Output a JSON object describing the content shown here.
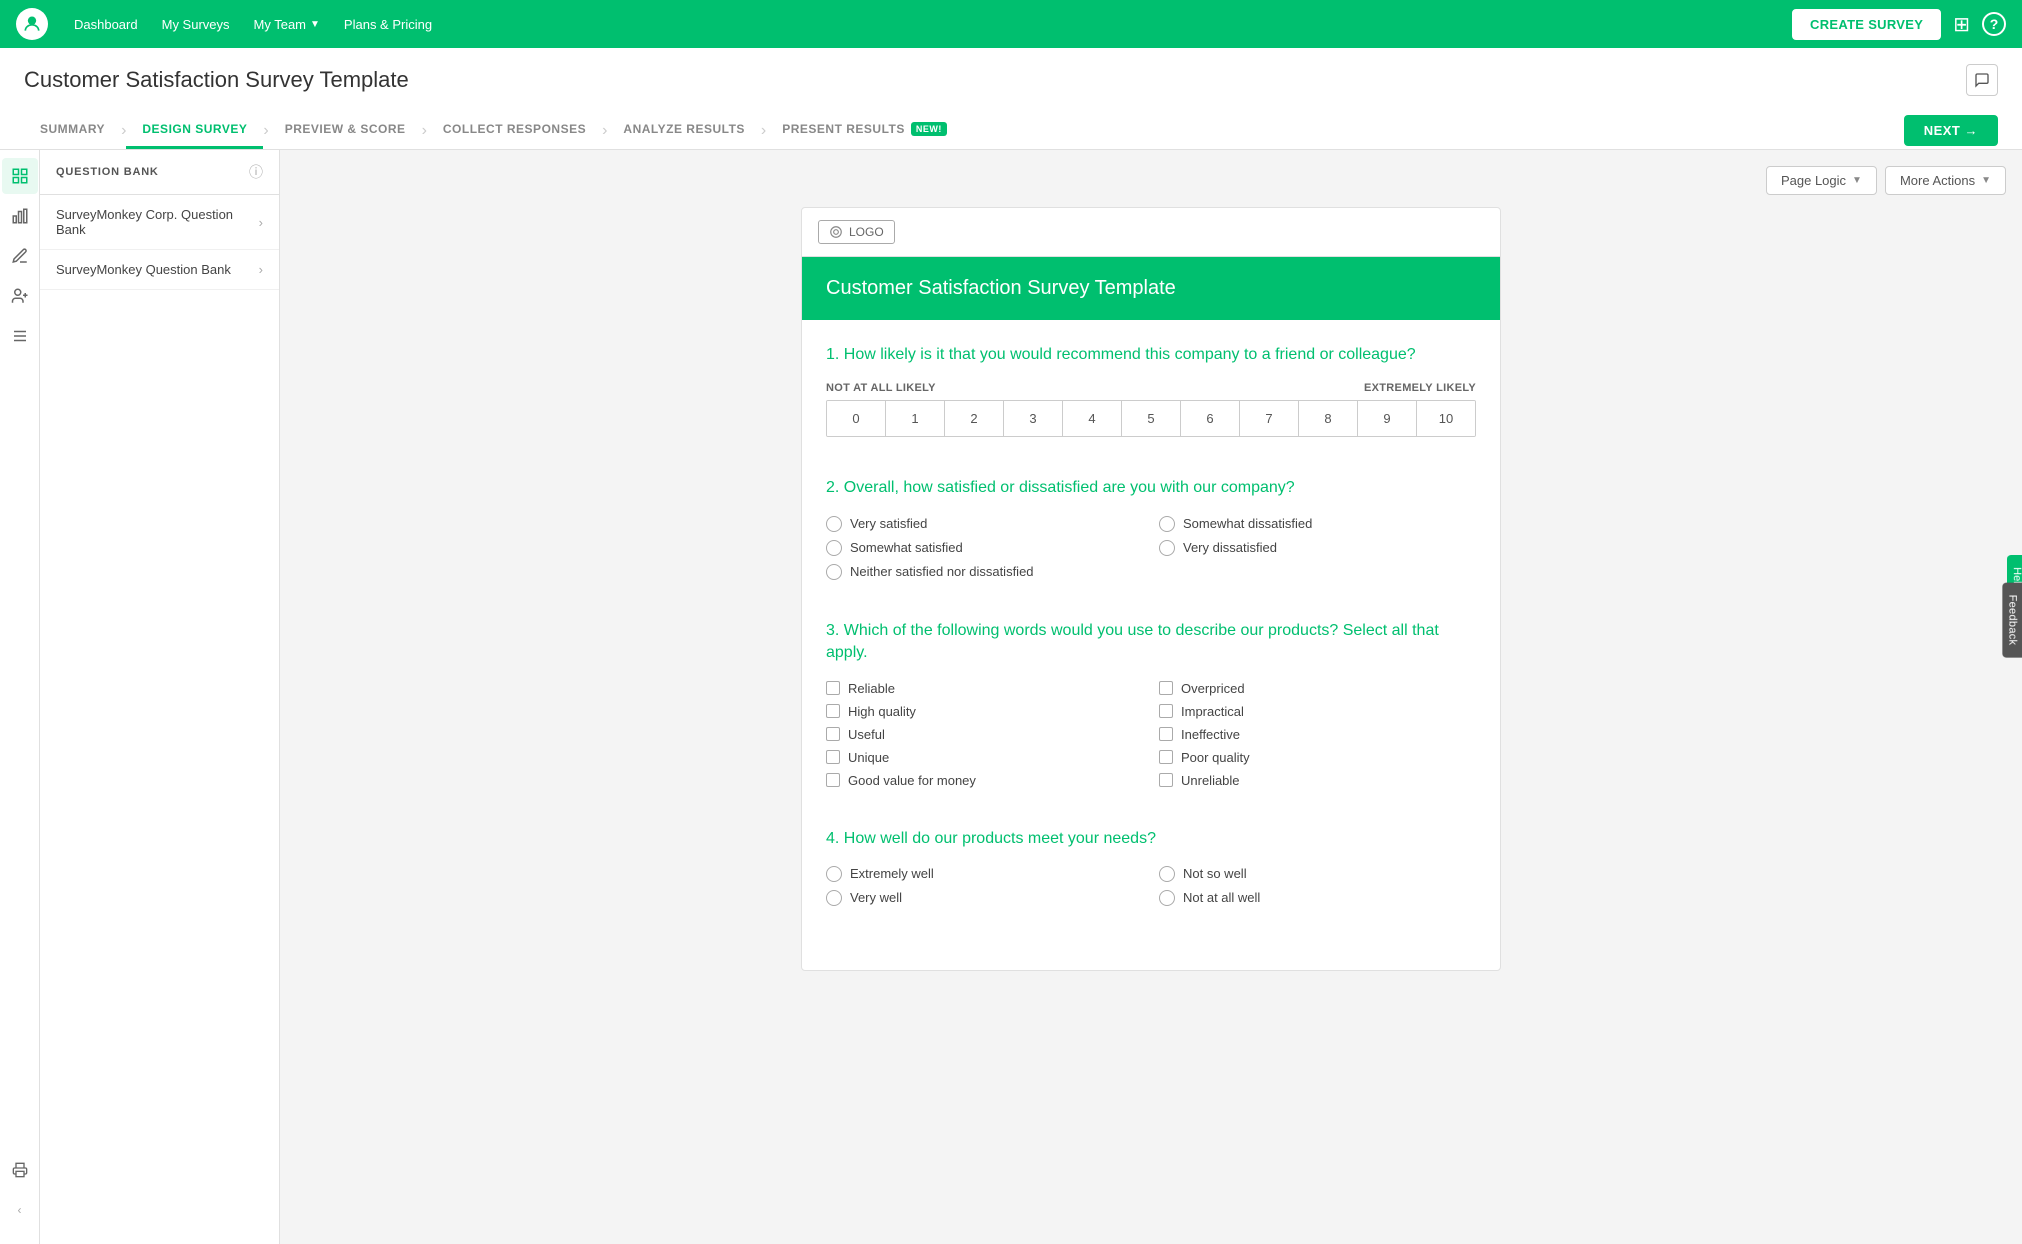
{
  "topNav": {
    "links": [
      {
        "id": "dashboard",
        "label": "Dashboard"
      },
      {
        "id": "my-surveys",
        "label": "My Surveys"
      },
      {
        "id": "my-team",
        "label": "My Team",
        "hasDropdown": true
      },
      {
        "id": "plans-pricing",
        "label": "Plans & Pricing"
      }
    ],
    "createSurveyLabel": "CREATE SURVEY",
    "gridIconLabel": "grid",
    "helpIconLabel": "?"
  },
  "pageTitle": "Customer Satisfaction Survey Template",
  "tabs": [
    {
      "id": "summary",
      "label": "SUMMARY"
    },
    {
      "id": "design-survey",
      "label": "DESIGN SURVEY",
      "active": true
    },
    {
      "id": "preview-score",
      "label": "PREVIEW & SCORE"
    },
    {
      "id": "collect-responses",
      "label": "COLLECT RESPONSES"
    },
    {
      "id": "analyze-results",
      "label": "ANALYZE RESULTS"
    },
    {
      "id": "present-results",
      "label": "PRESENT RESULTS",
      "badge": "NEW!"
    }
  ],
  "nextBtn": "NEXT →",
  "sidebarIcons": [
    {
      "id": "question-bank",
      "icon": "☰",
      "active": true
    },
    {
      "id": "chart",
      "icon": "📊",
      "active": false
    },
    {
      "id": "pencil",
      "icon": "✏️",
      "active": false
    },
    {
      "id": "add-user",
      "icon": "👤+",
      "active": false
    },
    {
      "id": "sliders",
      "icon": "⊞",
      "active": false
    }
  ],
  "sidebarBottomIcons": [
    {
      "id": "print",
      "icon": "🖨"
    }
  ],
  "questionBank": {
    "title": "QUESTION BANK",
    "infoIcon": "?",
    "items": [
      {
        "id": "corp-bank",
        "label": "SurveyMonkey Corp. Question Bank"
      },
      {
        "id": "sm-bank",
        "label": "SurveyMonkey Question Bank"
      }
    ]
  },
  "toolbar": {
    "pageLogicLabel": "Page Logic",
    "moreActionsLabel": "More Actions",
    "actionsLabel": "Actions"
  },
  "survey": {
    "logoPlaceholder": "LOGO",
    "headerTitle": "Customer Satisfaction Survey Template",
    "questions": [
      {
        "id": "q1",
        "number": "1.",
        "text": "How likely is it that you would recommend this company to a friend or colleague?",
        "type": "nps",
        "npsLabels": {
          "left": "NOT AT ALL LIKELY",
          "right": "EXTREMELY LIKELY"
        },
        "npsValues": [
          "0",
          "1",
          "2",
          "3",
          "4",
          "5",
          "6",
          "7",
          "8",
          "9",
          "10"
        ]
      },
      {
        "id": "q2",
        "number": "2.",
        "text": "Overall, how satisfied or dissatisfied are you with our company?",
        "type": "radio",
        "options": [
          [
            "Very satisfied",
            "Somewhat dissatisfied"
          ],
          [
            "Somewhat satisfied",
            "Very dissatisfied"
          ],
          [
            "Neither satisfied nor dissatisfied",
            ""
          ]
        ]
      },
      {
        "id": "q3",
        "number": "3.",
        "text": "Which of the following words would you use to describe our products? Select all that apply.",
        "type": "checkbox",
        "options": [
          [
            "Reliable",
            "Overpriced"
          ],
          [
            "High quality",
            "Impractical"
          ],
          [
            "Useful",
            "Ineffective"
          ],
          [
            "Unique",
            "Poor quality"
          ],
          [
            "Good value for money",
            "Unreliable"
          ]
        ]
      },
      {
        "id": "q4",
        "number": "4.",
        "text": "How well do our products meet your needs?",
        "type": "radio",
        "options": [
          [
            "Extremely well",
            "Not so well"
          ],
          [
            "Very well",
            "Not at all well"
          ]
        ]
      }
    ]
  },
  "helpTab": "Help!",
  "feedbackTab": "Feedback",
  "collapseBtn": "‹"
}
